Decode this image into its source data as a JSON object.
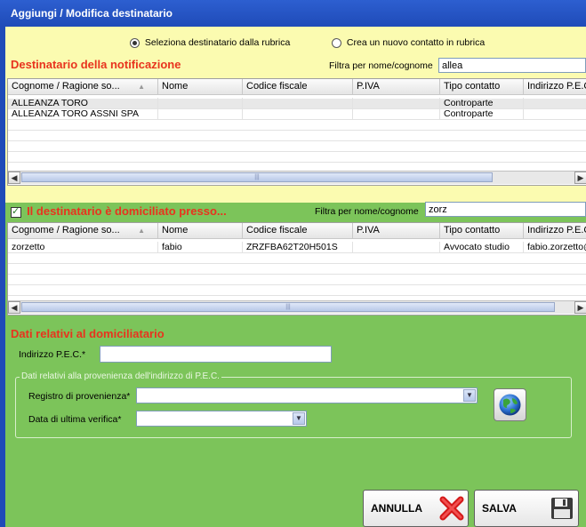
{
  "window": {
    "title": "Aggiungi / Modifica destinatario"
  },
  "source_options": {
    "rubrica": "Seleziona destinatario dalla rubrica",
    "nuovo": "Crea un nuovo contatto in rubrica",
    "selected": "rubrica"
  },
  "destinatario": {
    "title": "Destinatario della notificazione",
    "filter_label": "Filtra per nome/cognome",
    "filter_value": "allea",
    "columns": [
      "Cognome / Ragione so...",
      "Nome",
      "Codice fiscale",
      "P.IVA",
      "Tipo contatto",
      "Indirizzo P.E.C"
    ],
    "rows": [
      [
        "ALLEANZA TORO",
        "",
        "",
        "",
        "Controparte",
        ""
      ],
      [
        "ALLEANZA TORO ASSNI SPA",
        "",
        "",
        "",
        "Controparte",
        ""
      ]
    ]
  },
  "domicilio": {
    "checkbox_label": "Il destinatario è domiciliato presso...",
    "checked": true,
    "filter_label": "Filtra per nome/cognome",
    "filter_value": "zorz",
    "columns": [
      "Cognome / Ragione so...",
      "Nome",
      "Codice fiscale",
      "P.IVA",
      "Tipo contatto",
      "Indirizzo P.E.C"
    ],
    "rows": [
      [
        "zorzetto",
        "fabio",
        "ZRZFBA62T20H501S",
        "",
        "Avvocato studio",
        "fabio.zorzetto@"
      ]
    ]
  },
  "domiciliatario": {
    "title": "Dati relativi al domiciliatario",
    "pec_label": "Indirizzo P.E.C.*",
    "pec_value": "",
    "group_title": "Dati relativi alla provenienza dell'indirizzo di P.E.C.",
    "registro_label": "Registro di provenienza*",
    "registro_value": "",
    "data_label": "Data di ultima verifica*",
    "data_value": ""
  },
  "buttons": {
    "annulla": "ANNULLA",
    "salva": "SALVA"
  },
  "icons": {
    "globe": "globe-icon",
    "cancel": "red-x-icon",
    "save": "floppy-disk-icon"
  },
  "colors": {
    "title_red": "#e8331e",
    "yellow_bg": "#fbfbb0",
    "green_bg": "#7cc45a",
    "titlebar": "#1f4bb8"
  }
}
